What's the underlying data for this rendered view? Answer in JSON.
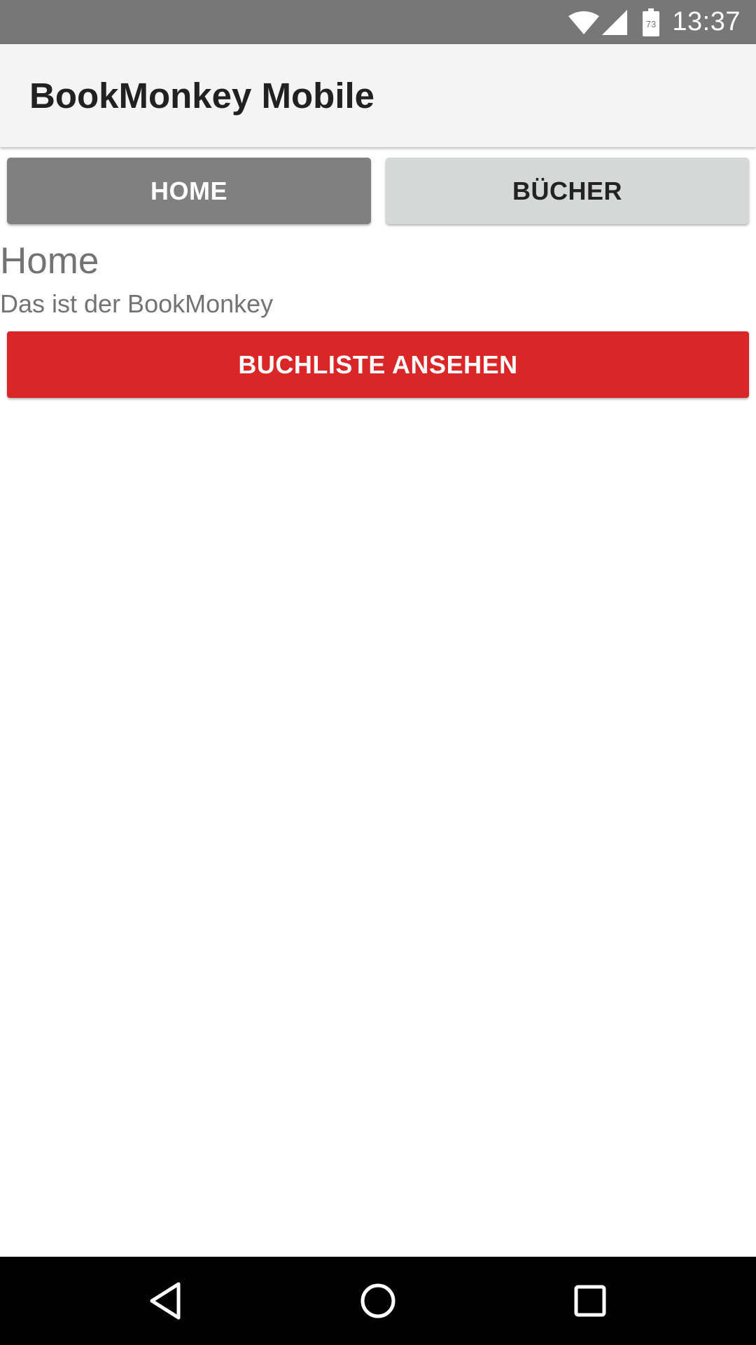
{
  "status_bar": {
    "time": "13:37",
    "battery_level": "73",
    "icons": [
      "wifi-icon",
      "cell-signal-icon",
      "battery-icon"
    ],
    "background_color": "#777777"
  },
  "app_bar": {
    "title": "BookMonkey Mobile",
    "background_color": "#f4f4f4"
  },
  "nav": {
    "home_label": "HOME",
    "books_label": "BÜCHER",
    "active": "home",
    "active_color": "#808080",
    "inactive_color": "#d6d7d7"
  },
  "content": {
    "heading": "Home",
    "text": "Das ist der BookMonkey",
    "cta_label": "BUCHLISTE ANSEHEN",
    "cta_color": "#db2628"
  },
  "system_nav": {
    "icons": [
      "back-icon",
      "home-circle-icon",
      "recent-apps-icon"
    ]
  }
}
